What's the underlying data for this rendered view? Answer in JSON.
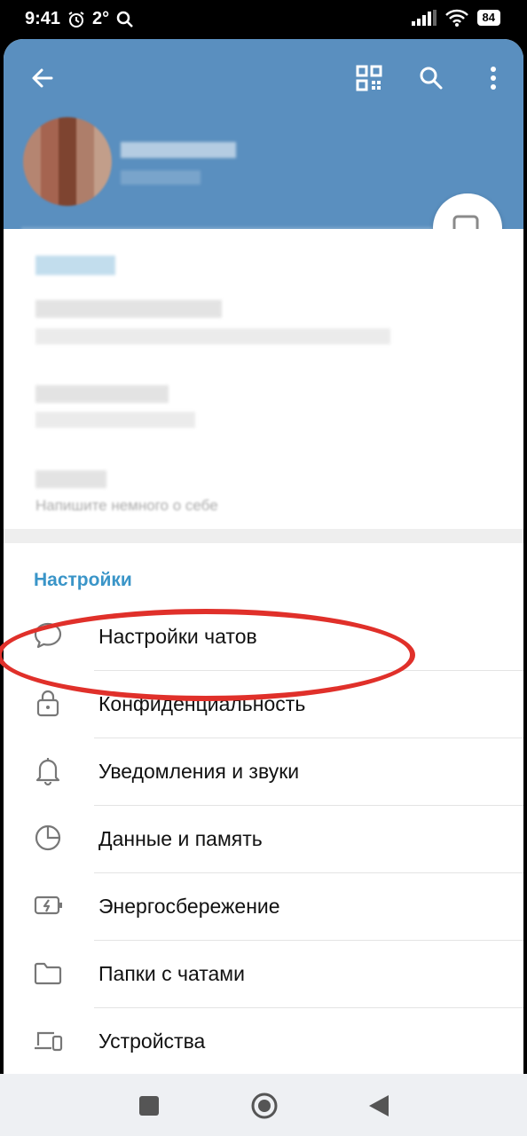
{
  "status_bar": {
    "time": "9:41",
    "temperature": "2°",
    "battery": "84",
    "icons": [
      "alarm-icon",
      "search-icon",
      "signal-icon",
      "wifi-icon",
      "battery-icon"
    ]
  },
  "header": {
    "back_icon": "arrow-left-icon",
    "qr_icon": "qr-code-icon",
    "search_icon": "search-icon",
    "menu_icon": "more-vertical-icon",
    "color": "#5a8fbf"
  },
  "profile": {
    "bio_placeholder": "Напишите немного о себе"
  },
  "settings": {
    "section_title": "Настройки",
    "items": [
      {
        "label": "Настройки чатов",
        "icon": "chat-bubble-icon"
      },
      {
        "label": "Конфиденциальность",
        "icon": "lock-icon"
      },
      {
        "label": "Уведомления и звуки",
        "icon": "bell-icon"
      },
      {
        "label": "Данные и память",
        "icon": "pie-chart-icon"
      },
      {
        "label": "Энергосбережение",
        "icon": "battery-charge-icon"
      },
      {
        "label": "Папки с чатами",
        "icon": "folder-icon"
      },
      {
        "label": "Устройства",
        "icon": "devices-icon"
      }
    ],
    "accent": "#3a95c8",
    "highlight_color": "#e0302a"
  },
  "nav": {
    "icons": [
      "recent-apps-icon",
      "home-icon",
      "back-icon"
    ]
  }
}
